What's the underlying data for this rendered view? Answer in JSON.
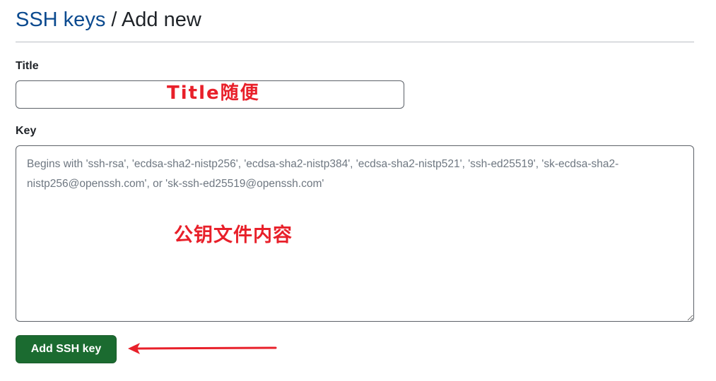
{
  "header": {
    "breadcrumb_link": "SSH keys",
    "separator": "/",
    "current_page": "Add new"
  },
  "form": {
    "title_label": "Title",
    "title_value": "",
    "key_label": "Key",
    "key_value": "",
    "key_placeholder": "Begins with 'ssh-rsa', 'ecdsa-sha2-nistp256', 'ecdsa-sha2-nistp384', 'ecdsa-sha2-nistp521', 'ssh-ed25519', 'sk-ecdsa-sha2-nistp256@openssh.com', or 'sk-ssh-ed25519@openssh.com'",
    "submit_label": "Add SSH key"
  },
  "annotations": {
    "title_note": "Title随便",
    "key_note": "公钥文件内容",
    "color": "#e8202a"
  },
  "colors": {
    "link": "#0b4a8f",
    "button_bg": "#1b6b30",
    "button_text": "#ffffff"
  }
}
